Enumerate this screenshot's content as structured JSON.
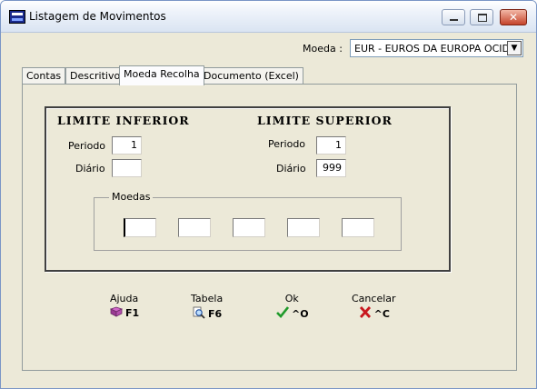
{
  "window": {
    "title": "Listagem de Movimentos",
    "controls": {
      "minimize": "",
      "maximize": "",
      "close": "✕"
    }
  },
  "currency": {
    "label": "Moeda :",
    "selected": "EUR - EUROS DA EUROPA OCID"
  },
  "tabs": [
    {
      "label": "Contas"
    },
    {
      "label": "Descritivo"
    },
    {
      "label": "Moeda Recolha",
      "active": true
    },
    {
      "label": "Documento (Excel)"
    }
  ],
  "limits": {
    "lower": {
      "title": "LIMITE INFERIOR",
      "periodo_label": "Periodo",
      "periodo_value": "1",
      "diario_label": "Diário",
      "diario_value": ""
    },
    "upper": {
      "title": "LIMITE SUPERIOR",
      "periodo_label": "Periodo",
      "periodo_value": "1",
      "diario_label": "Diário",
      "diario_value": "999"
    }
  },
  "moedas": {
    "label": "Moedas",
    "fields": [
      "",
      "",
      "",
      "",
      ""
    ]
  },
  "actions": [
    {
      "label": "Ajuda",
      "key": "F1",
      "icon": "book-icon"
    },
    {
      "label": "Tabela",
      "key": "F6",
      "icon": "magnifier-icon"
    },
    {
      "label": "Ok",
      "key": "^O",
      "icon": "checkmark-icon"
    },
    {
      "label": "Cancelar",
      "key": "^C",
      "icon": "red-x-icon"
    }
  ],
  "colors": {
    "window_bg": "#ece9d8",
    "accent_ok": "#1f9a2a",
    "accent_cancel": "#c8171e"
  }
}
